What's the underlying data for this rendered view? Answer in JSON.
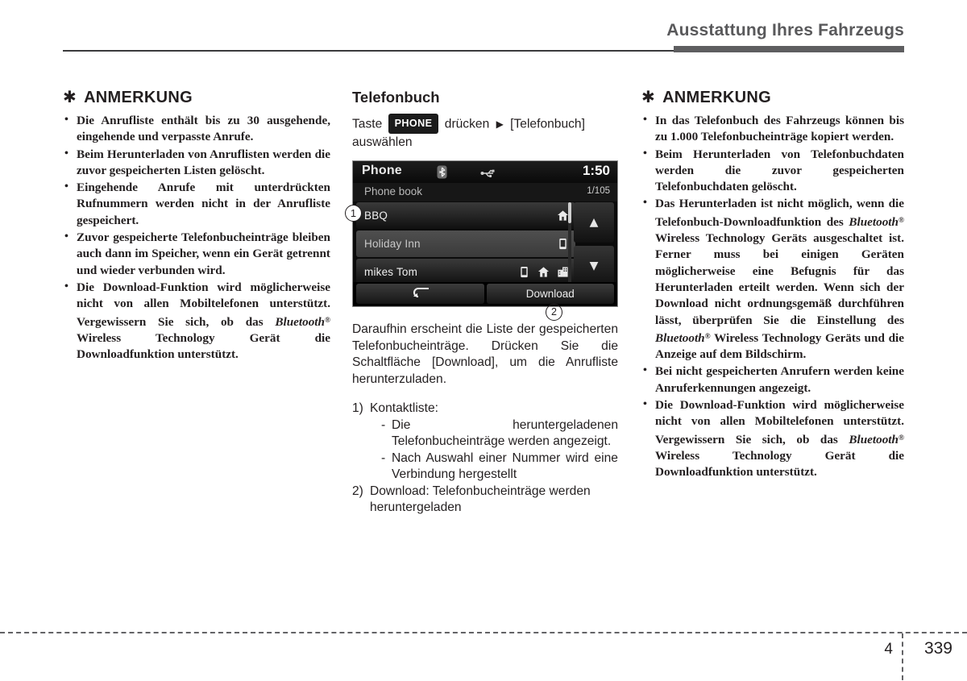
{
  "header": {
    "title": "Ausstattung Ihres Fahrzeugs"
  },
  "footer": {
    "chapter": "4",
    "page": "339"
  },
  "left_column": {
    "note": {
      "asterisk": "✱",
      "heading": "ANMERKUNG",
      "items": [
        "Die Anrufliste enthält bis zu 30 ausgehende, eingehende und verpasste Anrufe.",
        "Beim Herunterladen von Anruflisten werden die zuvor gespeicherten Listen gelöscht.",
        "Eingehende Anrufe mit unterdrückten Rufnummern werden nicht in der Anrufliste gespeichert.",
        "Zuvor gespeicherte Telefonbucheinträge bleiben auch dann im Speicher, wenn ein Gerät getrennt und wieder verbunden wird."
      ],
      "item5_part1": "Die Download-Funktion wird möglicherweise nicht von allen Mobiltelefonen unterstützt. Vergewissern Sie sich, ob das",
      "item5_bt": "Bluetooth",
      "item5_reg": "®",
      "item5_part2": "Wireless Technology Gerät die Downloadfunktion unterstützt."
    }
  },
  "middle_column": {
    "section_heading": "Telefonbuch",
    "step": {
      "prefix": "Taste",
      "key_label": "PHONE",
      "middle": "drücken",
      "arrow": "▶",
      "target": "[Telefonbuch]",
      "suffix": "auswählen"
    },
    "device": {
      "title": "Phone",
      "bluetooth_icon": "bluetooth-icon",
      "usb_icon": "usb-icon",
      "clock": "1:50",
      "list_title": "Phone book",
      "count": "1/105",
      "rows": [
        {
          "label": "BBQ",
          "icons": [
            "home-icon"
          ]
        },
        {
          "label": "Holiday Inn",
          "icons": [
            "mobile-icon"
          ]
        },
        {
          "label": "mikes Tom",
          "icons": [
            "mobile-icon",
            "home-icon",
            "office-icon"
          ]
        }
      ],
      "scroll_up": "▲",
      "scroll_down": "▼",
      "back_button": "back-arrow-icon",
      "download_button": "Download",
      "callout_1": "1",
      "callout_2": "2"
    },
    "paragraph": "Daraufhin erscheint die Liste der gespeicherten Telefonbucheinträge. Drücken Sie die Schaltfläche [Download], um die Anrufliste herunterzuladen.",
    "numbered_list": [
      {
        "marker": "1)",
        "label": "Kontaktliste:",
        "sub_items": [
          "Die heruntergeladenen Telefonbucheinträge werden angezeigt.",
          "Nach Auswahl einer Nummer wird eine Verbindung hergestellt"
        ]
      },
      {
        "marker": "2)",
        "label": "Download: Telefonbucheinträge werden heruntergeladen",
        "sub_items": []
      }
    ],
    "dash": "-"
  },
  "right_column": {
    "note": {
      "asterisk": "✱",
      "heading": "ANMERKUNG",
      "items": [
        "In das Telefonbuch des Fahrzeugs können bis zu 1.000 Telefonbucheinträge kopiert werden.",
        "Beim Herunterladen von Telefonbuchdaten werden die zuvor gespeicherten Telefonbuchdaten gelöscht."
      ],
      "item3_part1": "Das Herunterladen ist nicht möglich, wenn die Telefonbuch-Downloadfunktion des",
      "item3_bt": "Bluetooth",
      "item3_reg": "®",
      "item3_part2": "Wireless Technology Geräts ausgeschaltet ist. Ferner muss bei einigen Geräten möglicherweise eine Befugnis für das Herunterladen erteilt werden. Wenn sich der Download nicht ordnungsgemäß durchführen lässt, überprüfen Sie die Einstellung des",
      "item3_bt2": "Bluetooth",
      "item3_reg2": "®",
      "item3_part3": "Wireless Technology Geräts und die Anzeige auf dem Bildschirm.",
      "item4": "Bei nicht gespeicherten Anrufern werden keine Anruferkennungen angezeigt.",
      "item5_part1": "Die Download-Funktion wird möglicherweise nicht von allen Mobiltelefonen unterstützt. Vergewissern Sie sich, ob das",
      "item5_bt": "Bluetooth",
      "item5_reg": "®",
      "item5_part2": "Wireless Technology Gerät die Downloadfunktion unterstützt."
    }
  }
}
